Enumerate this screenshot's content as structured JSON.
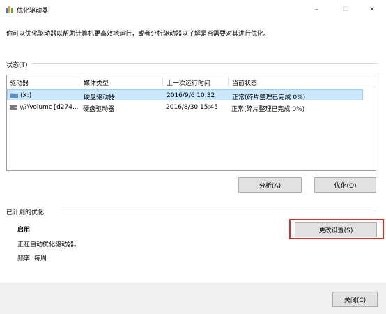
{
  "window": {
    "title": "优化驱动器",
    "minimize_glyph": "–",
    "maximize_glyph": "☐",
    "close_glyph": "✕"
  },
  "description": "你可以优化驱动器以帮助计算机更高效地运行，或者分析驱动器以了解是否需要对其进行优化。",
  "status": {
    "label": "状态(T)",
    "columns": [
      "驱动器",
      "媒体类型",
      "上一次运行时间",
      "当前状态"
    ],
    "rows": [
      {
        "drive": "(X:)",
        "media": "硬盘驱动器",
        "last_run": "2016/9/6 10:32",
        "status": "正常(碎片整理已完成 0%)",
        "selected": true
      },
      {
        "drive": "\\\\?\\Volume{d274...",
        "media": "硬盘驱动器",
        "last_run": "2016/8/30 15:45",
        "status": "正常(碎片整理已完成 0%)",
        "selected": false
      }
    ]
  },
  "buttons": {
    "analyze": "分析(A)",
    "optimize": "优化(O)",
    "change_settings": "更改设置(S)",
    "close": "关闭(C)"
  },
  "schedule": {
    "label": "已计划的优化",
    "enabled": "启用",
    "auto_text": "正在自动优化驱动器。",
    "frequency": "频率: 每周"
  },
  "colors": {
    "selection": "#cce8ff",
    "highlight_border": "#e0292a",
    "footer_bg": "#f0f0f0"
  }
}
